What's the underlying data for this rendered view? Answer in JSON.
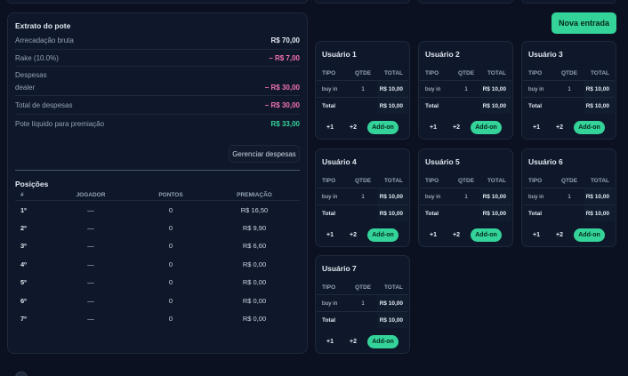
{
  "extrato": {
    "title": "Extrato do pote",
    "arrecadacao_label": "Arrecadação bruta",
    "arrecadacao_value": "R$ 70,00",
    "rake_label": "Rake (10.0%)",
    "rake_value": "− R$ 7,00",
    "despesas_label": "Despesas",
    "dealer_label": "dealer",
    "dealer_value": "− R$ 30,00",
    "total_despesas_label": "Total de despesas",
    "total_despesas_value": "− R$ 30,00",
    "pote_label": "Pote líquido para premiação",
    "pote_value": "R$ 33,00",
    "gerenciar_label": "Gerenciar despesas"
  },
  "posicoes": {
    "title": "Posições",
    "headers": [
      "#",
      "JOGADOR",
      "PONTOS",
      "PREMIAÇÃO"
    ],
    "rows": [
      {
        "pos": "1º",
        "jogador": "—",
        "pontos": "0",
        "premiacao": "R$ 16,50"
      },
      {
        "pos": "2º",
        "jogador": "—",
        "pontos": "0",
        "premiacao": "R$ 9,90"
      },
      {
        "pos": "3º",
        "jogador": "—",
        "pontos": "0",
        "premiacao": "R$ 6,60"
      },
      {
        "pos": "4º",
        "jogador": "—",
        "pontos": "0",
        "premiacao": "R$ 0,00"
      },
      {
        "pos": "5º",
        "jogador": "—",
        "pontos": "0",
        "premiacao": "R$ 0,00"
      },
      {
        "pos": "6º",
        "jogador": "—",
        "pontos": "0",
        "premiacao": "R$ 0,00"
      },
      {
        "pos": "7º",
        "jogador": "—",
        "pontos": "0",
        "premiacao": "R$ 0,00"
      }
    ]
  },
  "nova_entrada_label": "Nova entrada",
  "card_labels": {
    "col_tipo": "TIPO",
    "col_qtde": "QTDE",
    "col_total": "TOTAL",
    "row_tipo": "buy in",
    "row_qtde": "1",
    "row_total": "R$ 10,00",
    "total_label": "Total",
    "total_value": "R$ 10,00",
    "plus1": "+1",
    "plus2": "+2",
    "addon": "Add-on"
  },
  "users": [
    "Usuário 1",
    "Usuário 2",
    "Usuário 3",
    "Usuário 4",
    "Usuário 5",
    "Usuário 6",
    "Usuário 7"
  ],
  "colors": {
    "accent": "#34d399",
    "negative": "#f472b6",
    "background": "#0b1120",
    "panel": "#0f172a"
  }
}
